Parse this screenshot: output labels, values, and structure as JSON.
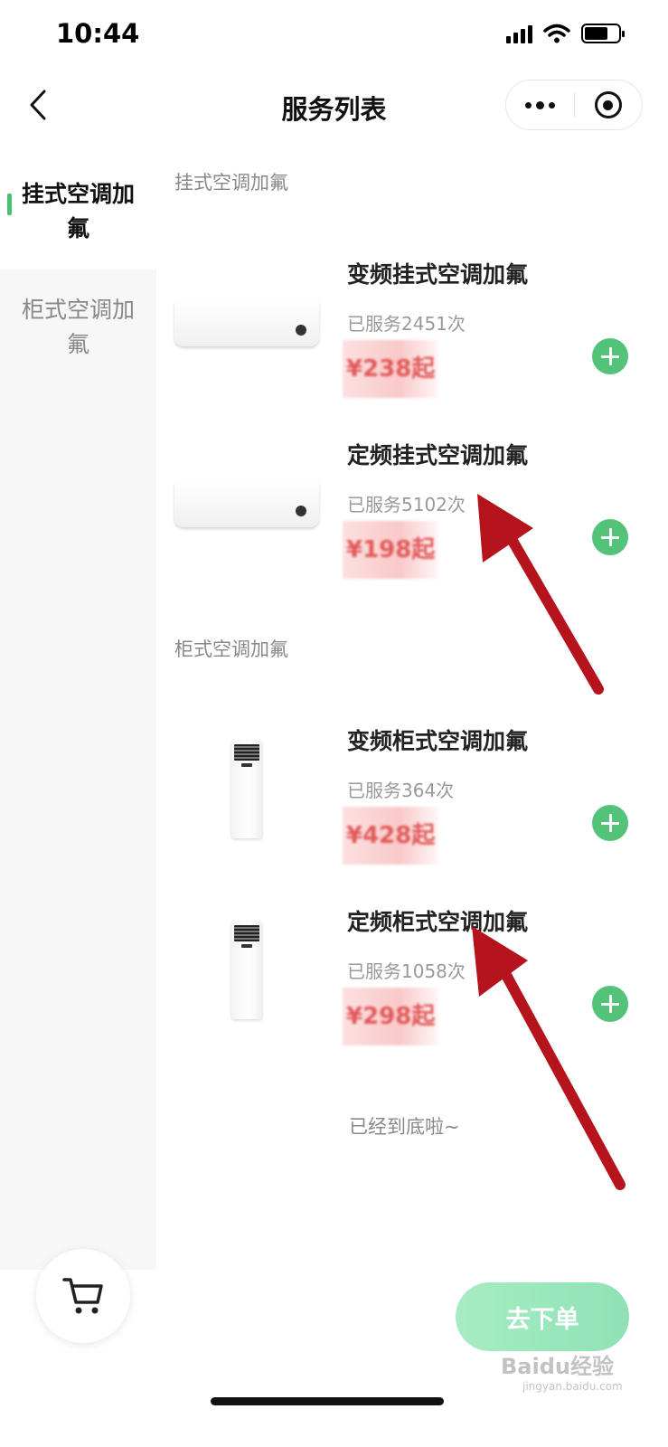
{
  "status_bar": {
    "time": "10:44"
  },
  "nav": {
    "title": "服务列表",
    "more_icon": "more-dots-icon",
    "close_icon": "target-icon"
  },
  "sidebar": {
    "items": [
      {
        "label": "挂式空调加氟",
        "active": true
      },
      {
        "label": "柜式空调加氟",
        "active": false
      }
    ]
  },
  "sections": [
    {
      "title": "挂式空调加氟",
      "items": [
        {
          "name": "变频挂式空调加氟",
          "sold": "已服务2451次",
          "price": "¥238起",
          "image": "wall-ac-icon"
        },
        {
          "name": "定频挂式空调加氟",
          "sold": "已服务5102次",
          "price": "¥198起",
          "image": "wall-ac-icon"
        }
      ]
    },
    {
      "title": "柜式空调加氟",
      "items": [
        {
          "name": "变频柜式空调加氟",
          "sold": "已服务364次",
          "price": "¥428起",
          "image": "floor-ac-icon"
        },
        {
          "name": "定频柜式空调加氟",
          "sold": "已服务1058次",
          "price": "¥298起",
          "image": "floor-ac-icon"
        }
      ]
    }
  ],
  "list_end_hint": "已经到底啦~",
  "footer": {
    "order_label": "去下单",
    "cart_icon": "cart-icon"
  },
  "watermark": {
    "text": "Baidu经验",
    "sub": "jingyan.baidu.com"
  },
  "colors": {
    "accent_green": "#52c378",
    "price_red": "#e25a5a",
    "annotation_red": "#b5141c"
  }
}
